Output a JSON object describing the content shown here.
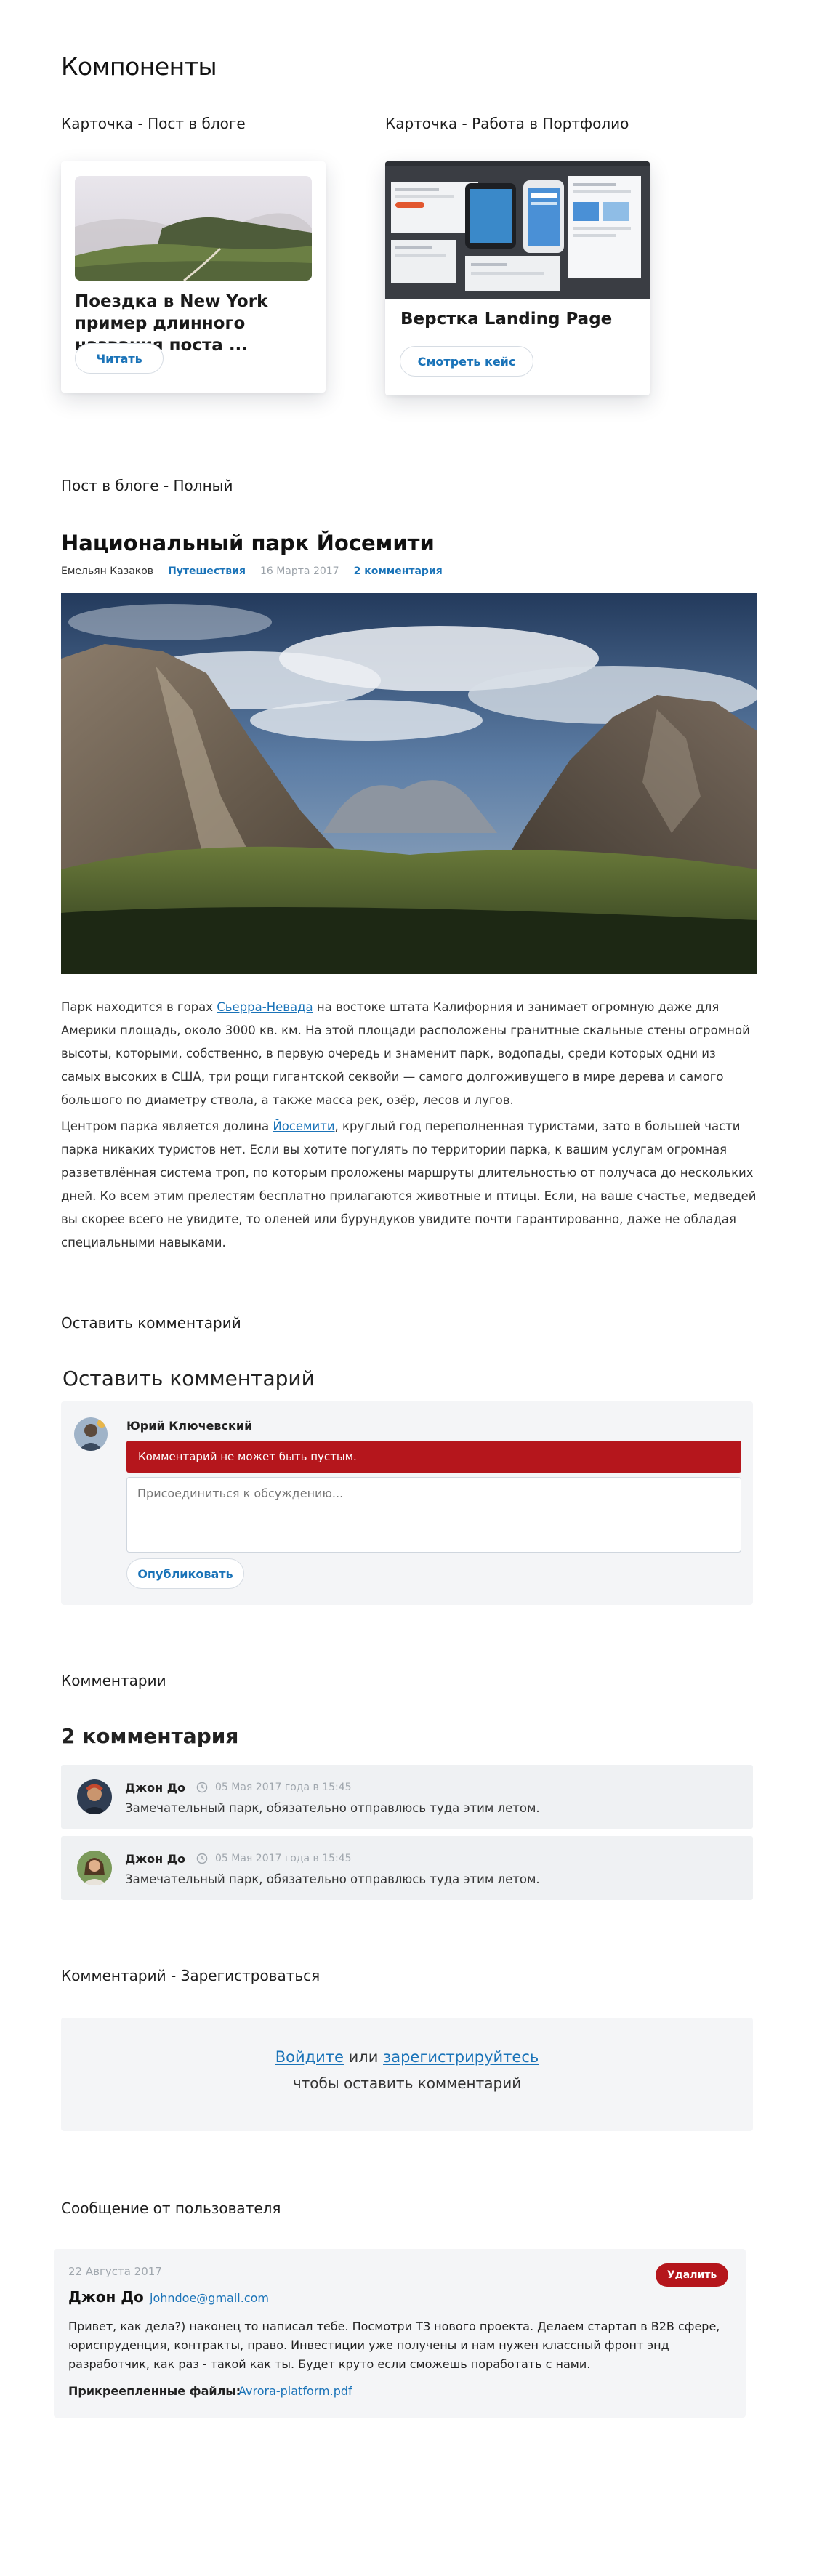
{
  "page": {
    "title": "Компоненты"
  },
  "sections": {
    "card_blog": "Карточка - Пост в блоге",
    "card_portfolio": "Карточка - Работа в Портфолио",
    "post_full": "Пост в блоге - Полный",
    "leave_comment": "Оставить комментарий",
    "comments": "Комментарии",
    "comment_register": "Комментарий - Зарегистроваться",
    "user_message": "Сообщение от пользователя"
  },
  "card_blog": {
    "title": "Поездка в New York пример длинного названия поста ...",
    "button": "Читать"
  },
  "card_portfolio": {
    "title": "Верстка Landing Page",
    "button": "Смотреть кейс"
  },
  "post": {
    "title": "Национальный парк Йосемити",
    "author": "Емельян Казаков",
    "category": "Путешествия",
    "date": "16 Марта 2017",
    "comments": "2 комментария",
    "p1_before": "Парк находится в горах ",
    "p1_link": "Сьерра-Невада",
    "p1_after": " на востоке штата Калифорния и занимает огромную даже для Америки площадь, около 3000 кв. км. На этой площади расположены гранитные скальные стены огромной высоты, которыми, собственно, в первую очередь и знаменит парк, водопады, среди которых одни из самых высоких в США, три рощи гигантской секвойи — самого долгоживущего в мире дерева и самого большого по диаметру ствола, а также масса рек, озёр, лесов и лугов.",
    "p2_before": "Центром парка является долина ",
    "p2_link": "Йосемити",
    "p2_after": ", круглый год переполненная туристами, зато в большей части парка никаких туристов нет. Если вы хотите погулять по территории парка, к вашим услугам огромная разветвлённая система троп, по которым проложены маршруты длительностью от получаса до нескольких дней. Ко всем этим прелестям бесплатно прилагаются животные и птицы. Если, на ваше счастье, медведей вы скорее всего не увидите, то оленей или бурундуков увидите почти гарантированно, даже не обладая специальными навыками."
  },
  "comment_form": {
    "heading": "Оставить комментарий",
    "user": "Юрий Ключевский",
    "error": "Комментарий не может быть пустым.",
    "placeholder": "Присоединиться к обсуждению...",
    "submit": "Опубликовать"
  },
  "comments": {
    "heading": "2 комментария",
    "items": [
      {
        "name": "Джон До",
        "date": "05 Мая 2017 года в 15:45",
        "text": "Замечательный парк, обязательно отправлюсь туда этим летом."
      },
      {
        "name": "Джон До",
        "date": "05 Мая 2017 года в 15:45",
        "text": "Замечательный парк, обязательно отправлюсь туда этим летом."
      }
    ]
  },
  "register": {
    "login": "Войдите",
    "or": " или ",
    "signup": "зарегистрируйтесь",
    "line2": "чтобы оставить комментарий"
  },
  "message": {
    "date": "22 Августа 2017",
    "name": "Джон До",
    "email": "johndoe@gmail.com",
    "delete": "Удалить",
    "text": "Привет, как дела?) наконец то написал тебе. Посмотри ТЗ нового проекта. Делаем стартап в B2B сфере, юриспруденция, контракты, право. Инвестиции уже получены и нам нужен классный фронт энд разработчик, как раз - такой как ты. Будет круто если сможешь поработать с нами.",
    "files_label": "Прикреепленные файлы:",
    "file": "Avrora-platform.pdf"
  },
  "colors": {
    "accent": "#1a73b8",
    "error": "#b5161c",
    "panel": "#f4f5f7"
  }
}
